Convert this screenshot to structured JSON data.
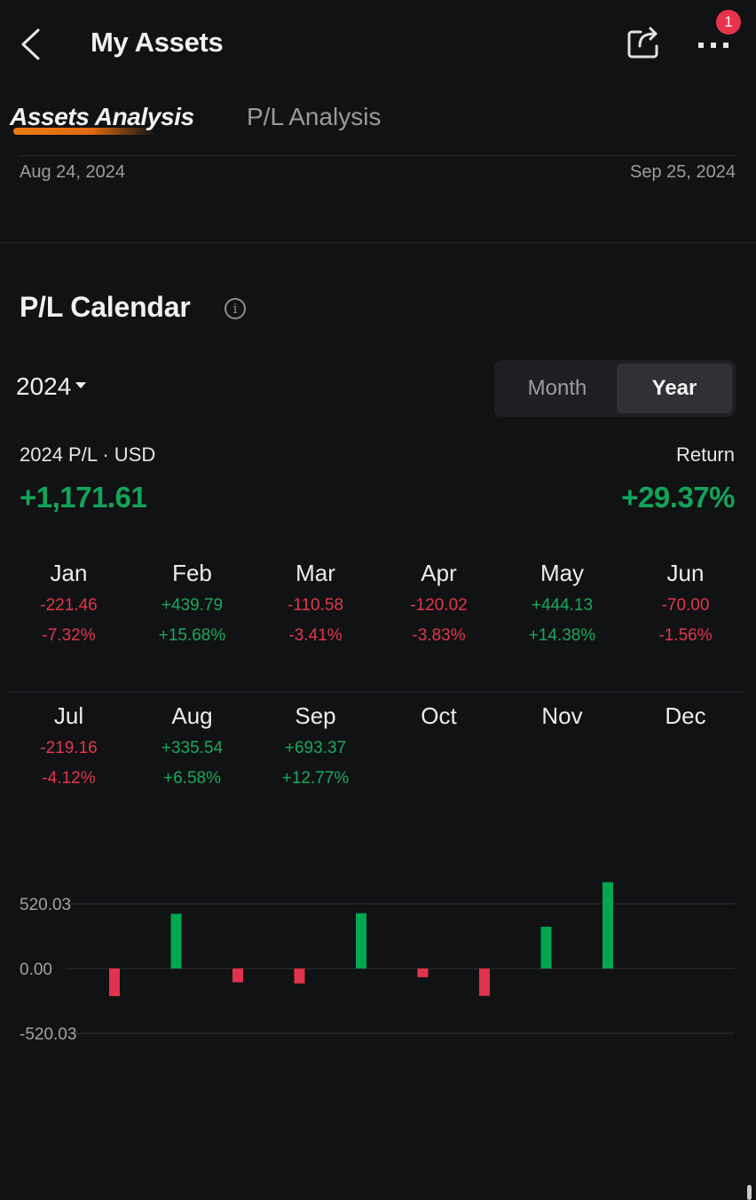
{
  "header": {
    "title": "My Assets",
    "back_icon": "chevron-left-icon",
    "share_icon": "share-icon",
    "more_icon": "more-horizontal-icon",
    "notification_badge": "1"
  },
  "tabs": [
    {
      "label": "Assets Analysis",
      "active": true
    },
    {
      "label": "P/L Analysis",
      "active": false
    }
  ],
  "date_range": {
    "start": "Aug 24, 2024",
    "end": "Sep 25, 2024"
  },
  "calendar": {
    "title": "P/L Calendar",
    "info_icon": "info-icon",
    "year": "2024",
    "view_toggle": [
      {
        "label": "Month",
        "active": false
      },
      {
        "label": "Year",
        "active": true
      }
    ],
    "summary": {
      "pl_label": "2024 P/L · USD",
      "pl_value": "+1,171.61",
      "return_label": "Return",
      "return_value": "+29.37%"
    },
    "months": [
      {
        "name": "Jan",
        "pl": "-221.46",
        "pct": "-7.32%"
      },
      {
        "name": "Feb",
        "pl": "+439.79",
        "pct": "+15.68%"
      },
      {
        "name": "Mar",
        "pl": "-110.58",
        "pct": "-3.41%"
      },
      {
        "name": "Apr",
        "pl": "-120.02",
        "pct": "-3.83%"
      },
      {
        "name": "May",
        "pl": "+444.13",
        "pct": "+14.38%"
      },
      {
        "name": "Jun",
        "pl": "-70.00",
        "pct": "-1.56%"
      },
      {
        "name": "Jul",
        "pl": "-219.16",
        "pct": "-4.12%"
      },
      {
        "name": "Aug",
        "pl": "+335.54",
        "pct": "+6.58%"
      },
      {
        "name": "Sep",
        "pl": "+693.37",
        "pct": "+12.77%"
      },
      {
        "name": "Oct",
        "pl": "",
        "pct": ""
      },
      {
        "name": "Nov",
        "pl": "",
        "pct": ""
      },
      {
        "name": "Dec",
        "pl": "",
        "pct": ""
      }
    ]
  },
  "colors": {
    "positive": "#00a650",
    "negative": "#e0334c",
    "accent": "#f07a12",
    "background": "#111214"
  },
  "chart_data": {
    "type": "bar",
    "title": "",
    "xlabel": "",
    "ylabel": "",
    "categories": [
      "Jan",
      "Feb",
      "Mar",
      "Apr",
      "May",
      "Jun",
      "Jul",
      "Aug",
      "Sep",
      "Oct",
      "Nov",
      "Dec"
    ],
    "values": [
      -221.46,
      439.79,
      -110.58,
      -120.02,
      444.13,
      -70.0,
      -219.16,
      335.54,
      693.37,
      null,
      null,
      null
    ],
    "ylim": [
      -520.03,
      520.03
    ],
    "yticks": [
      "520.03",
      "0.00",
      "-520.03"
    ],
    "ytick_values": [
      520.03,
      0,
      -520.03
    ],
    "grid": true,
    "legend": "none"
  }
}
